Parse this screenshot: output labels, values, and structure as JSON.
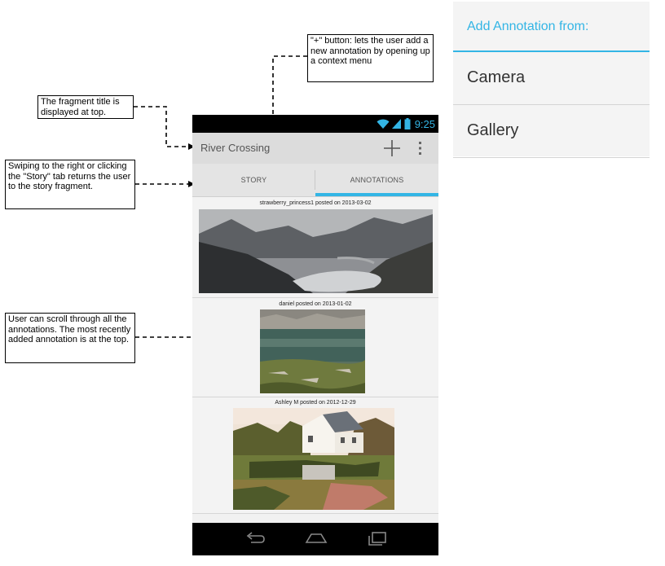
{
  "annotations": {
    "title_note": "The fragment title is displayed at top.",
    "plus_note": "\"+\" button: lets the user add a new annotation by opening up a context menu",
    "swipe_note": "Swiping to the right or clicking the \"Story\" tab returns the user to the story fragment.",
    "scroll_note": "User can scroll through all the annotations. The most recently added annotation is at the top."
  },
  "phone": {
    "status_time": "9:25",
    "title": "River Crossing",
    "tabs": [
      "STORY",
      "ANNOTATIONS"
    ],
    "active_tab": "ANNOTATIONS",
    "posts": [
      {
        "caption": "strawberry_princess1 posted on 2013-03-02",
        "image": "mountain-river-photo"
      },
      {
        "caption": "daniel posted on 2013-01-02",
        "image": "lake-shore-photo"
      },
      {
        "caption": "Ashley M posted on 2012-12-29",
        "image": "house-reflection-painting"
      }
    ]
  },
  "context_menu": {
    "header": "Add Annotation from:",
    "items": [
      "Camera",
      "Gallery"
    ]
  },
  "colors": {
    "accent": "#33b5e5",
    "action_bar": "#dcdcdc",
    "background": "#f1f1f1"
  }
}
